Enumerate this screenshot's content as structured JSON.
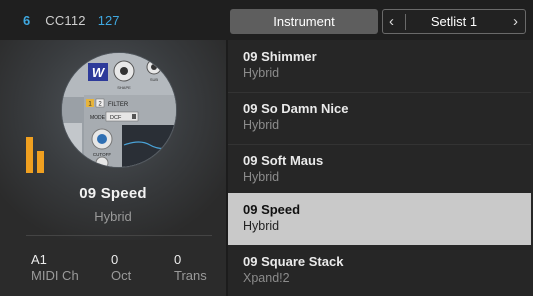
{
  "topbar": {
    "channel": "6",
    "cc": "CC112",
    "cc_value": "127",
    "instrument_tab": "Instrument",
    "setlist": "Setlist 1",
    "prev_icon": "chevron-left-icon",
    "next_icon": "chevron-right-icon"
  },
  "colors": {
    "accent_blue": "#3fa8e0",
    "accent_orange": "#f0a020",
    "selected_row": "#c9c9c9"
  },
  "current": {
    "name": "09 Speed",
    "type": "Hybrid",
    "stats": [
      {
        "value": "A1",
        "label": "MIDI Ch"
      },
      {
        "value": "0",
        "label": "Oct"
      },
      {
        "value": "0",
        "label": "Trans"
      }
    ]
  },
  "artwork": {
    "logo": "W",
    "filter_label": "FILTER",
    "mode_label": "MODE",
    "mode_value": "DCF",
    "knob_label": "CUTOFF",
    "shape_label": "SHAPE",
    "sub_label": "SUB",
    "num_1": "1",
    "num_2": "2"
  },
  "list": [
    {
      "name": "09 Shimmer",
      "type": "Hybrid",
      "selected": false
    },
    {
      "name": "09 So Damn Nice",
      "type": "Hybrid",
      "selected": false
    },
    {
      "name": "09 Soft Maus",
      "type": "Hybrid",
      "selected": false
    },
    {
      "name": "09 Speed",
      "type": "Hybrid",
      "selected": true
    },
    {
      "name": "09 Square Stack",
      "type": "Xpand!2",
      "selected": false
    }
  ]
}
